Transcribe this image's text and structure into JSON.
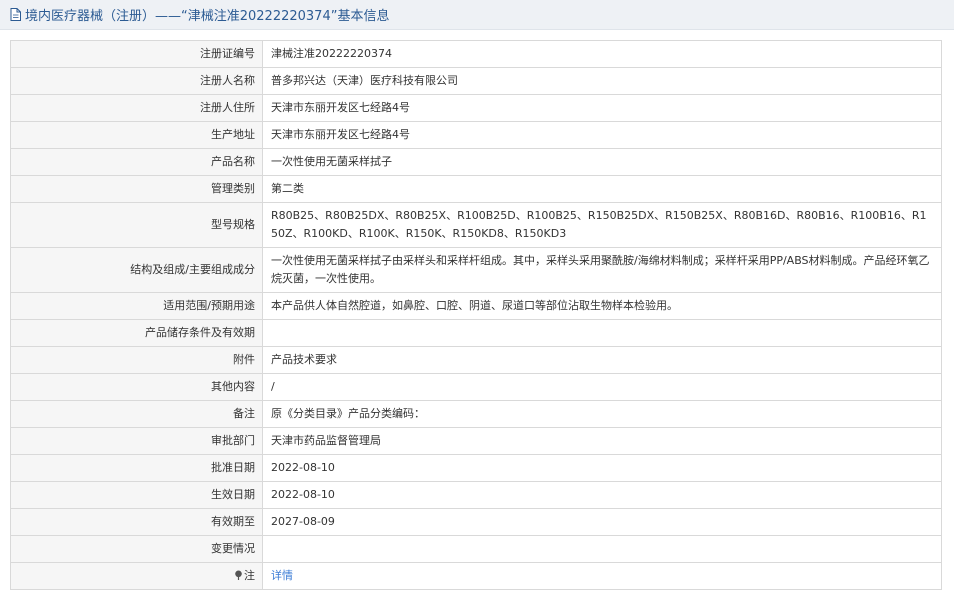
{
  "header": {
    "title": "境内医疗器械（注册）——“津械注准20222220374”基本信息",
    "icon": "document-icon"
  },
  "rows": [
    {
      "label": "注册证编号",
      "value": "津械注准20222220374"
    },
    {
      "label": "注册人名称",
      "value": "普多邦兴达（天津）医疗科技有限公司"
    },
    {
      "label": "注册人住所",
      "value": "天津市东丽开发区七经路4号"
    },
    {
      "label": "生产地址",
      "value": "天津市东丽开发区七经路4号"
    },
    {
      "label": "产品名称",
      "value": "一次性使用无菌采样拭子"
    },
    {
      "label": "管理类别",
      "value": "第二类"
    },
    {
      "label": "型号规格",
      "value": "R80B25、R80B25DX、R80B25X、R100B25D、R100B25、R150B25DX、R150B25X、R80B16D、R80B16、R100B16、R150Z、R100KD、R100K、R150K、R150KD8、R150KD3"
    },
    {
      "label": "结构及组成/主要组成成分",
      "value": "一次性使用无菌采样拭子由采样头和采样杆组成。其中，采样头采用聚酰胺/海绵材料制成；采样杆采用PP/ABS材料制成。产品经环氧乙烷灭菌，一次性使用。"
    },
    {
      "label": "适用范围/预期用途",
      "value": "本产品供人体自然腔道，如鼻腔、口腔、阴道、尿道口等部位沾取生物样本检验用。"
    },
    {
      "label": "产品储存条件及有效期",
      "value": ""
    },
    {
      "label": "附件",
      "value": "产品技术要求"
    },
    {
      "label": "其他内容",
      "value": "/"
    },
    {
      "label": "备注",
      "value": "原《分类目录》产品分类编码："
    },
    {
      "label": "审批部门",
      "value": "天津市药品监督管理局"
    },
    {
      "label": "批准日期",
      "value": "2022-08-10"
    },
    {
      "label": "生效日期",
      "value": "2022-08-10"
    },
    {
      "label": "有效期至",
      "value": "2027-08-09"
    },
    {
      "label": "变更情况",
      "value": ""
    }
  ],
  "note_row": {
    "label": "注",
    "icon": "pin-icon",
    "link": "详情"
  },
  "colors": {
    "header_bg": "#eef1f5",
    "header_text": "#2c5b93",
    "label_bg": "#f6f6f6",
    "border": "#d9d9d9",
    "link": "#3a7bd5"
  }
}
